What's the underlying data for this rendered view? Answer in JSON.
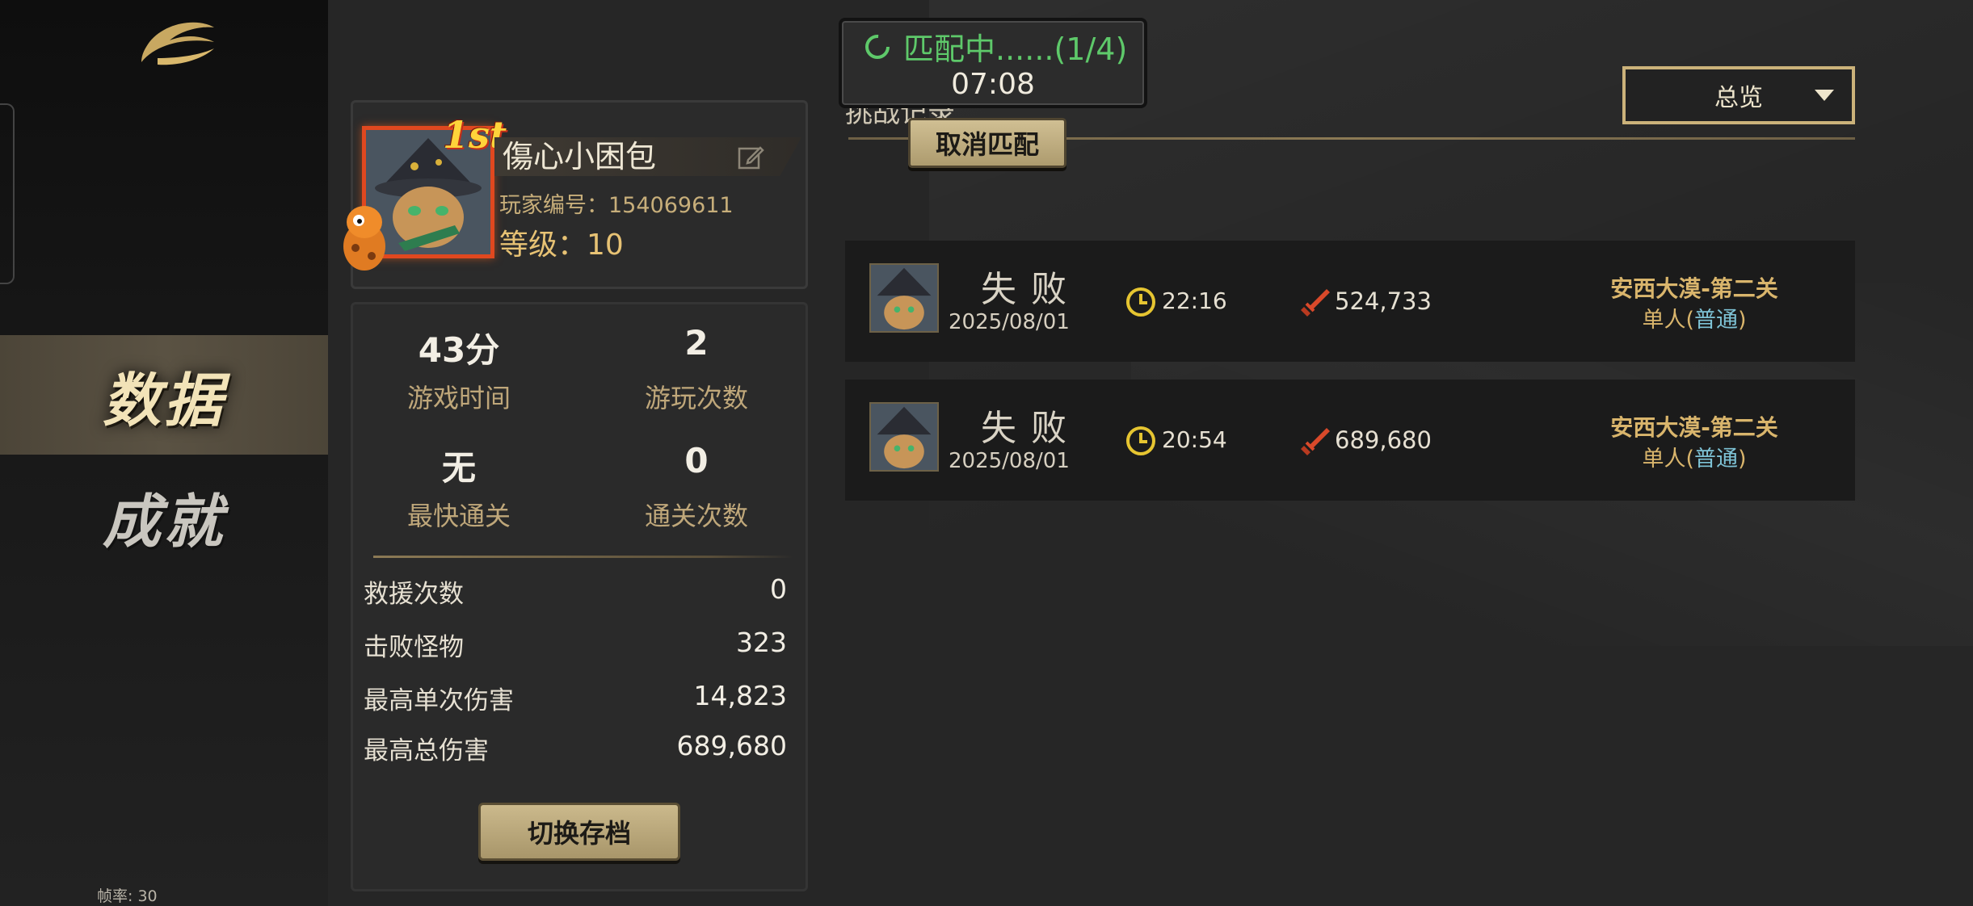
{
  "sidebar": {
    "nav": [
      {
        "label": "数据",
        "active": true
      },
      {
        "label": "成就",
        "active": false
      }
    ],
    "fps_label": "帧率: 30"
  },
  "profile": {
    "rank_badge": "1st",
    "name": "傷心小困包",
    "player_id_label": "玩家编号：",
    "player_id": "154069611",
    "level_label": "等级：",
    "level": "10"
  },
  "stats": {
    "play_time": {
      "value": "43分",
      "label": "游戏时间"
    },
    "play_count": {
      "value": "2",
      "label": "游玩次数"
    },
    "fastest_clear": {
      "value": "无",
      "label": "最快通关"
    },
    "clear_count": {
      "value": "0",
      "label": "通关次数"
    },
    "rows": [
      {
        "label": "救援次数",
        "value": "0"
      },
      {
        "label": "击败怪物",
        "value": "323"
      },
      {
        "label": "最高单次伤害",
        "value": "14,823"
      },
      {
        "label": "最高总伤害",
        "value": "689,680"
      }
    ],
    "switch_button": "切换存档"
  },
  "records": {
    "section_title": "挑战记录",
    "filter": {
      "selected": "总览"
    },
    "items": [
      {
        "result": "失败",
        "date": "2025/08/01",
        "time": "22:16",
        "damage": "524,733",
        "stage": "安西大漠-第二关",
        "mode_prefix": "单人(",
        "mode_highlight": "普通",
        "mode_suffix": ")"
      },
      {
        "result": "失败",
        "date": "2025/08/01",
        "time": "20:54",
        "damage": "689,680",
        "stage": "安西大漠-第二关",
        "mode_prefix": "单人(",
        "mode_highlight": "普通",
        "mode_suffix": ")"
      }
    ]
  },
  "matching": {
    "status": "匹配中......(1/4)",
    "timer": "07:08",
    "cancel_button": "取消匹配"
  },
  "colors": {
    "accent_gold": "#d9b56c",
    "matching_green": "#5ec96a",
    "mode_highlight": "#7ec3d6",
    "avatar_frame": "#e0481f"
  },
  "icons": [
    "game-logo-icon",
    "edit-icon",
    "clock-icon",
    "sword-icon",
    "spinner-icon",
    "chevron-down-icon"
  ]
}
